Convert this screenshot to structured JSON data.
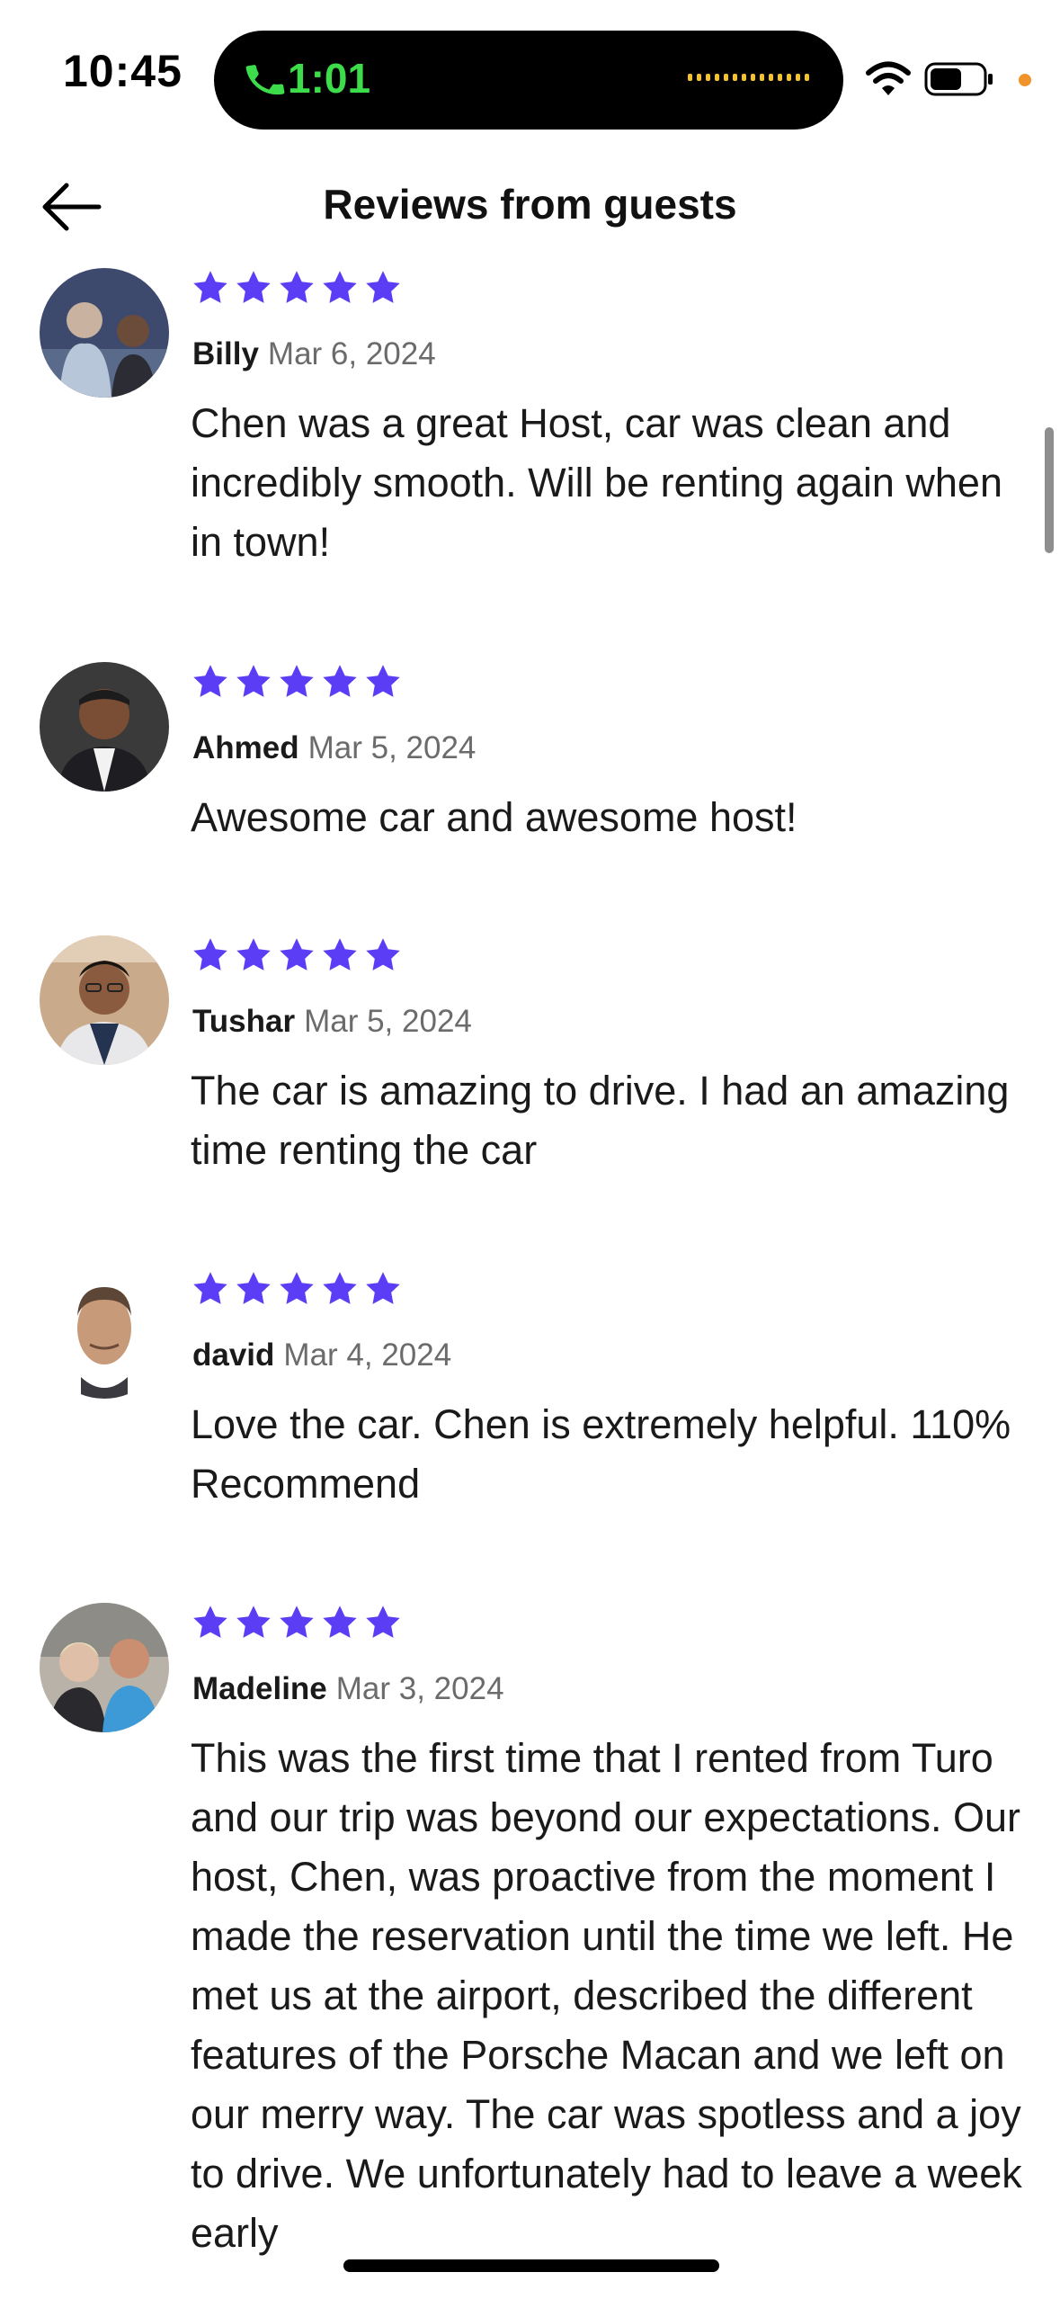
{
  "status_bar": {
    "time": "10:45",
    "call_timer": "1:01",
    "icons": [
      "phone-icon",
      "waveform-icon",
      "wifi-icon",
      "battery-icon",
      "privacy-dot"
    ]
  },
  "header": {
    "back_icon": "arrow-left-icon",
    "title": "Reviews from guests"
  },
  "colors": {
    "star": "#5b3df5",
    "call_green": "#3ddc4a",
    "privacy_orange": "#f0932b"
  },
  "reviews": [
    {
      "rating": 5,
      "name": "Billy",
      "date": "Mar 6, 2024",
      "text": "Chen was a great Host, car was clean and incredibly smooth. Will be renting again when in town!"
    },
    {
      "rating": 5,
      "name": "Ahmed",
      "date": "Mar 5, 2024",
      "text": "Awesome car and awesome host!"
    },
    {
      "rating": 5,
      "name": "Tushar",
      "date": "Mar 5, 2024",
      "text": "The car is amazing to drive. I had an amazing time renting the car"
    },
    {
      "rating": 5,
      "name": "david",
      "date": "Mar 4, 2024",
      "text": "Love the car.  Chen is extremely helpful. 110% Recommend"
    },
    {
      "rating": 5,
      "name": "Madeline",
      "date": "Mar 3, 2024",
      "text": "This was the first time that I rented from Turo and our trip was beyond our expectations.  Our host, Chen, was proactive from the moment I made the reservation until the time we left.  He met us at the airport, described the different features of the Porsche Macan and we left on our merry way.  The car was spotless and a joy to drive.  We unfortunately had to leave a week early"
    }
  ]
}
